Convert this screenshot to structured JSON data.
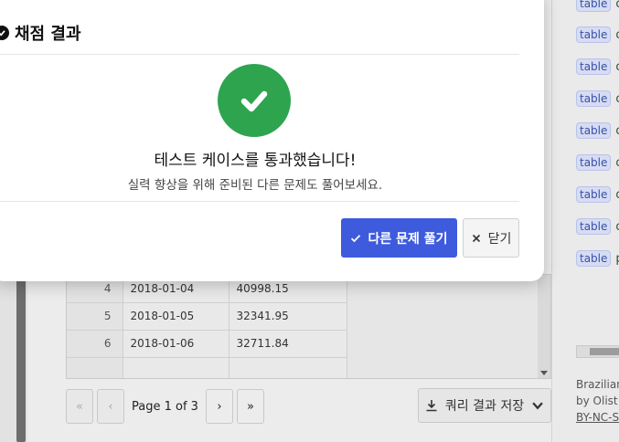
{
  "modal": {
    "title": "채점 결과",
    "success_message": "테스트 케이스를 통과했습니다!",
    "sub_message": "실력 향상을 위해 준비된 다른 문제도 풀어보세요.",
    "primary_button": "다른 문제 풀기",
    "close_button": "닫기"
  },
  "results_table": {
    "rows": [
      {
        "index": "4",
        "date": "2018-01-04",
        "value": "40998.15"
      },
      {
        "index": "5",
        "date": "2018-01-05",
        "value": "32341.95"
      },
      {
        "index": "6",
        "date": "2018-01-06",
        "value": "32711.84"
      }
    ]
  },
  "pagination": {
    "first_icon": "«",
    "prev_icon": "‹",
    "page_label": "Page 1 of 3",
    "next_icon": "›",
    "last_icon": "»"
  },
  "save_button": "쿼리 결과 저장",
  "sidebar": {
    "items": [
      {
        "badge": "table",
        "name": "o"
      },
      {
        "badge": "table",
        "name": "o"
      },
      {
        "badge": "table",
        "name": "o"
      },
      {
        "badge": "table",
        "name": "o"
      },
      {
        "badge": "table",
        "name": "o"
      },
      {
        "badge": "table",
        "name": "o"
      },
      {
        "badge": "table",
        "name": "o"
      },
      {
        "badge": "table",
        "name": "o"
      },
      {
        "badge": "table",
        "name": "p"
      }
    ],
    "footer_lines": [
      "Brazilian",
      "by Olist",
      "BY-NC-S"
    ]
  },
  "colors": {
    "primary": "#3e5bdd",
    "success": "#2ea44f",
    "badge_bg": "#d6dcf2"
  }
}
